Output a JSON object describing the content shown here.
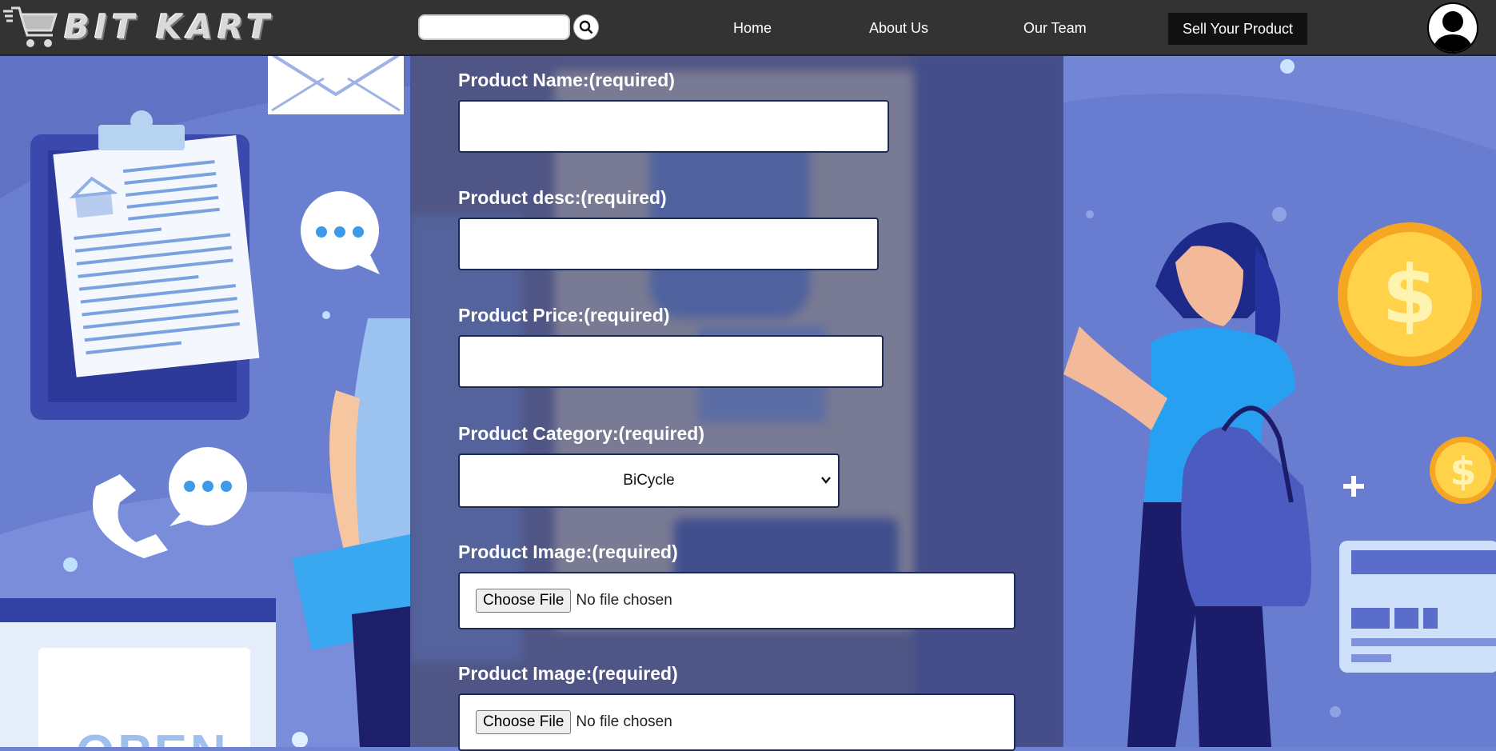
{
  "header": {
    "logo_text": "BIT KART",
    "search_placeholder": "",
    "nav": {
      "home": "Home",
      "about": "About Us",
      "team": "Our Team"
    },
    "sell_button": "Sell Your Product"
  },
  "form": {
    "product_name_label": "Product Name:(required)",
    "product_desc_label": "Product desc:(required)",
    "product_price_label": "Product Price:(required)",
    "product_category_label": "Product Category:(required)",
    "product_category_value": "BiCycle",
    "product_image_label_1": "Product Image:(required)",
    "product_image_label_2": "Product Image:(required)",
    "choose_file_label": "Choose File",
    "no_file_text": "No file chosen"
  },
  "background": {
    "open_sign_text": "OPEN"
  },
  "colors": {
    "navbar": "#333333",
    "sell_button": "#111111",
    "background_blue": "#6f83d4",
    "field_border": "#1b2a55"
  }
}
